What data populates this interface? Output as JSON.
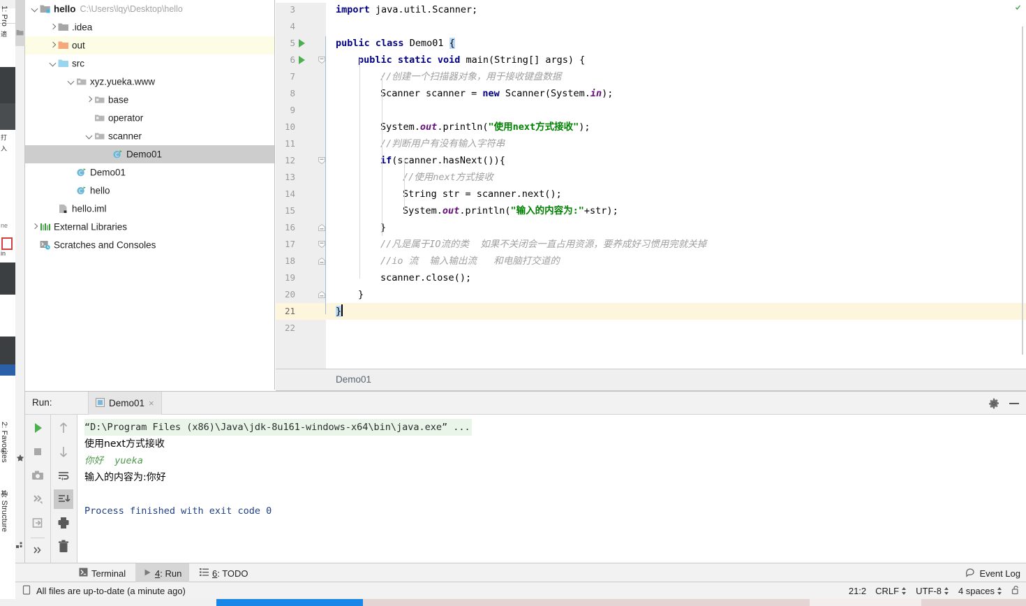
{
  "toolwindow_tabs_left": [
    {
      "num": "1",
      "label": ": Project",
      "icon": "project-folder-icon"
    },
    {
      "num": "2",
      "label": ": Favorites",
      "icon": "star-icon"
    },
    {
      "num": "7",
      "label": ": Structure",
      "icon": "structure-icon"
    }
  ],
  "project_tree": [
    {
      "indent": 0,
      "arrow": "down",
      "icon": "module-folder-icon",
      "label": "hello",
      "bold": true,
      "path": "C:\\Users\\lqy\\Desktop\\hello",
      "state": "normal"
    },
    {
      "indent": 1,
      "arrow": "right",
      "icon": "folder-gray-icon",
      "label": ".idea",
      "bold": false,
      "path": "",
      "state": "normal"
    },
    {
      "indent": 1,
      "arrow": "right",
      "icon": "folder-orange-icon",
      "label": "out",
      "bold": false,
      "path": "",
      "state": "highlight"
    },
    {
      "indent": 1,
      "arrow": "down",
      "icon": "folder-blue-icon",
      "label": "src",
      "bold": false,
      "path": "",
      "state": "normal"
    },
    {
      "indent": 2,
      "arrow": "down",
      "icon": "package-icon",
      "label": "xyz.yueka.www",
      "bold": false,
      "path": "",
      "state": "normal"
    },
    {
      "indent": 3,
      "arrow": "right",
      "icon": "package-icon",
      "label": "base",
      "bold": false,
      "path": "",
      "state": "normal"
    },
    {
      "indent": 3,
      "arrow": "none",
      "icon": "package-icon",
      "label": "operator",
      "bold": false,
      "path": "",
      "state": "normal"
    },
    {
      "indent": 3,
      "arrow": "down",
      "icon": "package-icon",
      "label": "scanner",
      "bold": false,
      "path": "",
      "state": "normal"
    },
    {
      "indent": 4,
      "arrow": "none",
      "icon": "java-class-run-icon",
      "label": "Demo01",
      "bold": false,
      "path": "",
      "state": "selected"
    },
    {
      "indent": 2,
      "arrow": "none",
      "icon": "java-class-run-icon",
      "label": "Demo01",
      "bold": false,
      "path": "",
      "state": "normal"
    },
    {
      "indent": 2,
      "arrow": "none",
      "icon": "java-class-run-icon",
      "label": "hello",
      "bold": false,
      "path": "",
      "state": "normal"
    },
    {
      "indent": 1,
      "arrow": "none",
      "icon": "iml-file-icon",
      "label": "hello.iml",
      "bold": false,
      "path": "",
      "state": "normal"
    },
    {
      "indent": 0,
      "arrow": "right",
      "icon": "libraries-icon",
      "label": "External Libraries",
      "bold": false,
      "path": "",
      "state": "normal"
    },
    {
      "indent": 0,
      "arrow": "none",
      "icon": "scratches-icon",
      "label": "Scratches and Consoles",
      "bold": false,
      "path": "",
      "state": "normal"
    }
  ],
  "editor": {
    "breadcrumb": "Demo01",
    "first_visible_line": 3,
    "current_line": 21,
    "lines": [
      {
        "n": 3,
        "runmark": false,
        "fold": "none",
        "indent": 0,
        "text": "import java.util.Scanner;"
      },
      {
        "n": 4,
        "runmark": false,
        "fold": "none",
        "indent": 0,
        "text": ""
      },
      {
        "n": 5,
        "runmark": true,
        "fold": "none",
        "indent": 0,
        "text": "public class Demo01 {"
      },
      {
        "n": 6,
        "runmark": true,
        "fold": "open",
        "indent": 1,
        "text": "public static void main(String[] args) {"
      },
      {
        "n": 7,
        "runmark": false,
        "fold": "none",
        "indent": 2,
        "text": "//创建一个扫描器对象，用于接收键盘数据"
      },
      {
        "n": 8,
        "runmark": false,
        "fold": "none",
        "indent": 2,
        "text": "Scanner scanner = new Scanner(System.in);"
      },
      {
        "n": 9,
        "runmark": false,
        "fold": "none",
        "indent": 2,
        "text": ""
      },
      {
        "n": 10,
        "runmark": false,
        "fold": "none",
        "indent": 2,
        "text": "System.out.println(\"使用next方式接收\");"
      },
      {
        "n": 11,
        "runmark": false,
        "fold": "none",
        "indent": 2,
        "text": "//判断用户有没有输入字符串"
      },
      {
        "n": 12,
        "runmark": false,
        "fold": "open",
        "indent": 2,
        "text": "if(scanner.hasNext()){"
      },
      {
        "n": 13,
        "runmark": false,
        "fold": "none",
        "indent": 3,
        "text": "//使用next方式接收"
      },
      {
        "n": 14,
        "runmark": false,
        "fold": "none",
        "indent": 3,
        "text": "String str = scanner.next();"
      },
      {
        "n": 15,
        "runmark": false,
        "fold": "none",
        "indent": 3,
        "text": "System.out.println(\"输入的内容为:\"+str);"
      },
      {
        "n": 16,
        "runmark": false,
        "fold": "close",
        "indent": 2,
        "text": "}"
      },
      {
        "n": 17,
        "runmark": false,
        "fold": "open2",
        "indent": 2,
        "text": "//凡是属于IO流的类  如果不关闭会一直占用资源，要养成好习惯用完就关掉"
      },
      {
        "n": 18,
        "runmark": false,
        "fold": "close",
        "indent": 2,
        "text": "//io 流  输入输出流   和电脑打交道的"
      },
      {
        "n": 19,
        "runmark": false,
        "fold": "none",
        "indent": 2,
        "text": "scanner.close();"
      },
      {
        "n": 20,
        "runmark": false,
        "fold": "close",
        "indent": 1,
        "text": "}"
      },
      {
        "n": 21,
        "runmark": false,
        "fold": "none",
        "indent": 0,
        "text": "}"
      },
      {
        "n": 22,
        "runmark": false,
        "fold": "none",
        "indent": 0,
        "text": ""
      }
    ]
  },
  "run_window": {
    "title": "Run:",
    "tab_name": "Demo01",
    "close_glyph": "×",
    "toolbar_left": [
      {
        "name": "rerun-button",
        "glyph": "play"
      },
      {
        "name": "stop-button",
        "glyph": "stop"
      },
      {
        "name": "screenshot-button",
        "glyph": "camera"
      },
      {
        "name": "dump-threads-button",
        "glyph": "threads"
      },
      {
        "name": "export-button",
        "glyph": "export"
      },
      {
        "name": "more-button",
        "glyph": "chevrons"
      }
    ],
    "toolbar_right": [
      {
        "name": "up-button",
        "glyph": "arrow-up"
      },
      {
        "name": "down-button",
        "glyph": "arrow-down"
      },
      {
        "name": "soft-wrap-button",
        "glyph": "wrap"
      },
      {
        "name": "scroll-to-end-button",
        "glyph": "scroll-end",
        "selected": true
      },
      {
        "name": "print-button",
        "glyph": "printer"
      },
      {
        "name": "clear-all-button",
        "glyph": "trash"
      }
    ],
    "settings_icon": "gear-icon",
    "minimize_icon": "minimize-icon",
    "console": [
      {
        "kind": "command",
        "text": "“D:\\Program Files (x86)\\Java\\jdk-8u161-windows-x64\\bin\\java.exe” ..."
      },
      {
        "kind": "output",
        "text": "使用next方式接收"
      },
      {
        "kind": "userinput",
        "text": "你好  yueka"
      },
      {
        "kind": "output",
        "text": "输入的内容为:你好"
      },
      {
        "kind": "blank",
        "text": ""
      },
      {
        "kind": "exit",
        "text": "Process finished with exit code 0"
      }
    ]
  },
  "bottom_bar": {
    "items": [
      {
        "num": "",
        "label": "Terminal",
        "icon": "terminal-icon",
        "active": false
      },
      {
        "num": "4",
        "label": ": Run",
        "icon": "run-play-icon",
        "active": true
      },
      {
        "num": "6",
        "label": ": TODO",
        "icon": "todo-list-icon",
        "active": false
      }
    ],
    "event_log": {
      "label": "Event Log",
      "icon": "event-log-icon"
    }
  },
  "status_bar": {
    "message": "All files are up-to-date (a minute ago)",
    "message_icon": "file-sync-icon",
    "caret_position": "21:2",
    "line_separator": "CRLF",
    "encoding": "UTF-8",
    "indent": "4 spaces",
    "lock_icon": "unlocked-icon"
  },
  "colors": {
    "keyword": "#000080",
    "string": "#008000",
    "comment": "#a0a0a0",
    "static_field": "#660e7a",
    "selection": "#b9d9f4",
    "current_line": "#fdf6dd",
    "tree_selection": "#cdcdcd",
    "tree_highlight": "#fdfce4",
    "run_green": "#4caf50"
  }
}
